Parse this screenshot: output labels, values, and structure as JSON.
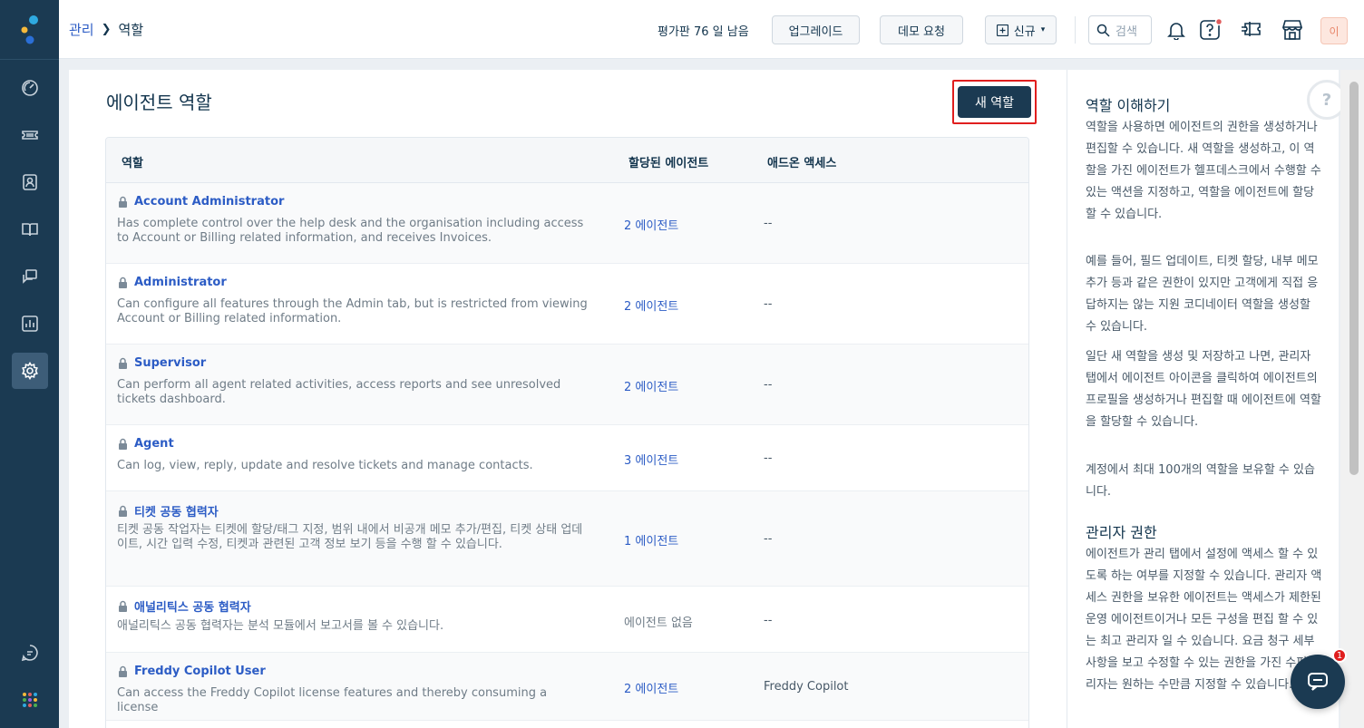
{
  "breadcrumb": {
    "parent": "관리",
    "current": "역할"
  },
  "header": {
    "trial_text": "평가판 76 일 남음",
    "upgrade_label": "업그레이드",
    "demo_label": "데모 요청",
    "new_label": "신규",
    "search_placeholder": "검색",
    "avatar_initial": "이"
  },
  "page": {
    "title": "에이전트 역할",
    "new_role_label": "새 역할"
  },
  "table": {
    "headers": {
      "role": "역할",
      "agents": "할당된 에이전트",
      "addon": "애드온 액세스"
    },
    "rows": [
      {
        "name": "Account Administrator",
        "desc": "Has complete control over the help desk and the organisation including access to Account or Billing related information, and receives Invoices.",
        "agents": "2 에이전트",
        "addon": "--"
      },
      {
        "name": "Administrator",
        "desc": "Can configure all features through the Admin tab, but is restricted from viewing Account or Billing related information.",
        "agents": "2 에이전트",
        "addon": "--"
      },
      {
        "name": "Supervisor",
        "desc": "Can perform all agent related activities, access reports and see unresolved tickets dashboard.",
        "agents": "2 에이전트",
        "addon": "--"
      },
      {
        "name": "Agent",
        "desc": "Can log, view, reply, update and resolve tickets and manage contacts.",
        "agents": "3 에이전트",
        "addon": "--"
      },
      {
        "name": "티켓 공동 협력자",
        "desc": "티켓 공동 작업자는 티켓에 할당/태그 지정, 범위 내에서 비공개 메모 추가/편집, 티켓 상태 업데이트, 시간 입력 수정, 티켓과 관련된 고객 정보 보기 등을 수행 할 수 있습니다.",
        "agents": "1 에이전트",
        "addon": "--"
      },
      {
        "name": "애널리틱스 공동 협력자",
        "desc": "애널리틱스 공동 협력자는 분석 모듈에서 보고서를 볼 수 있습니다.",
        "agents": "에이전트 없음",
        "addon": "--"
      },
      {
        "name": "Freddy Copilot User",
        "desc": "Can access the Freddy Copilot license features and thereby consuming a license",
        "agents": "2 에이전트",
        "addon": "Freddy Copilot"
      }
    ]
  },
  "help": {
    "heading1": "역할 이해하기",
    "p1": "역할을 사용하면 에이전트의 권한을 생성하거나 편집할 수 있습니다. 새 역할을 생성하고, 이 역할을 가진 에이전트가 헬프데스크에서 수행할 수 있는 액션을 지정하고, 역할을 에이전트에 할당할 수 있습니다.",
    "p2": "예를 들어, 필드 업데이트, 티켓 할당, 내부 메모 추가 등과 같은 권한이 있지만 고객에게 직접 응답하지는 않는 지원 코디네이터 역할을 생성할 수 있습니다.",
    "p3": "일단 새 역할을 생성 및 저장하고 나면, 관리자 탭에서 에이전트 아이콘을 클릭하여 에이전트의 프로필을 생성하거나 편집할 때 에이전트에 역할을 할당할 수 있습니다.",
    "p4": "계정에서 최대 100개의 역할을 보유할 수 있습니다.",
    "heading2": "관리자 권한",
    "p5": "에이전트가 관리 탭에서 설정에 액세스 할 수 있도록 하는 여부를 지정할 수 있습니다. 관리자 액세스 권한을 보유한 에이전트는 액세스가 제한된 운영 에이전트이거나 모든 구성을 편집 할 수 있는 최고 관리자 일 수 있습니다. 요금 청구 세부사항을 보고 수정할 수 있는 권한을 가진 수퍼 관리자는 원하는 수만큼 지정할 수 있습니다."
  },
  "chat": {
    "badge_count": "1"
  },
  "colors": {
    "nav_bg": "#1b3a52",
    "link": "#2c5cc5",
    "highlight": "#e01e1e"
  }
}
